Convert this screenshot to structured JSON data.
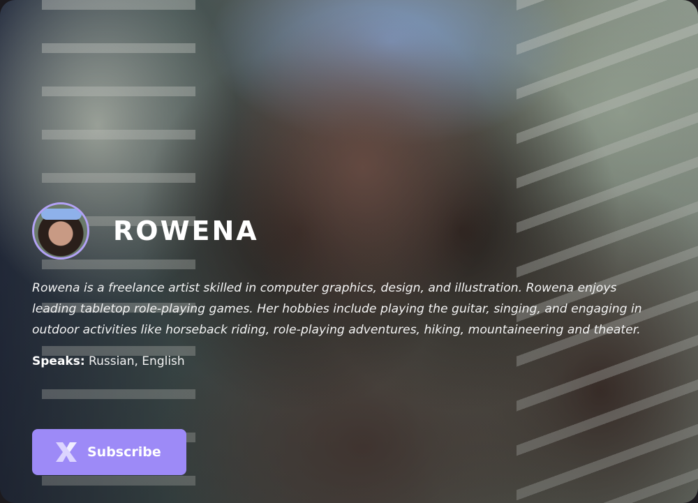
{
  "profile": {
    "name": "ROWENA",
    "bio": "Rowena is a freelance artist skilled in computer graphics, design, and illustration. Rowena enjoys leading tabletop role-playing games. Her hobbies include playing the guitar, singing, and engaging in outdoor activities like horseback riding, role-playing adventures, hiking, mountaineering and theater.",
    "speaks_label": "Speaks:",
    "languages": "Russian, English"
  },
  "subscribe": {
    "icon": "x-logo-icon",
    "label": "Subscribe"
  },
  "colors": {
    "accent": "#9d8af7",
    "avatar_ring": "#b3a2f6",
    "text": "#ffffff"
  }
}
